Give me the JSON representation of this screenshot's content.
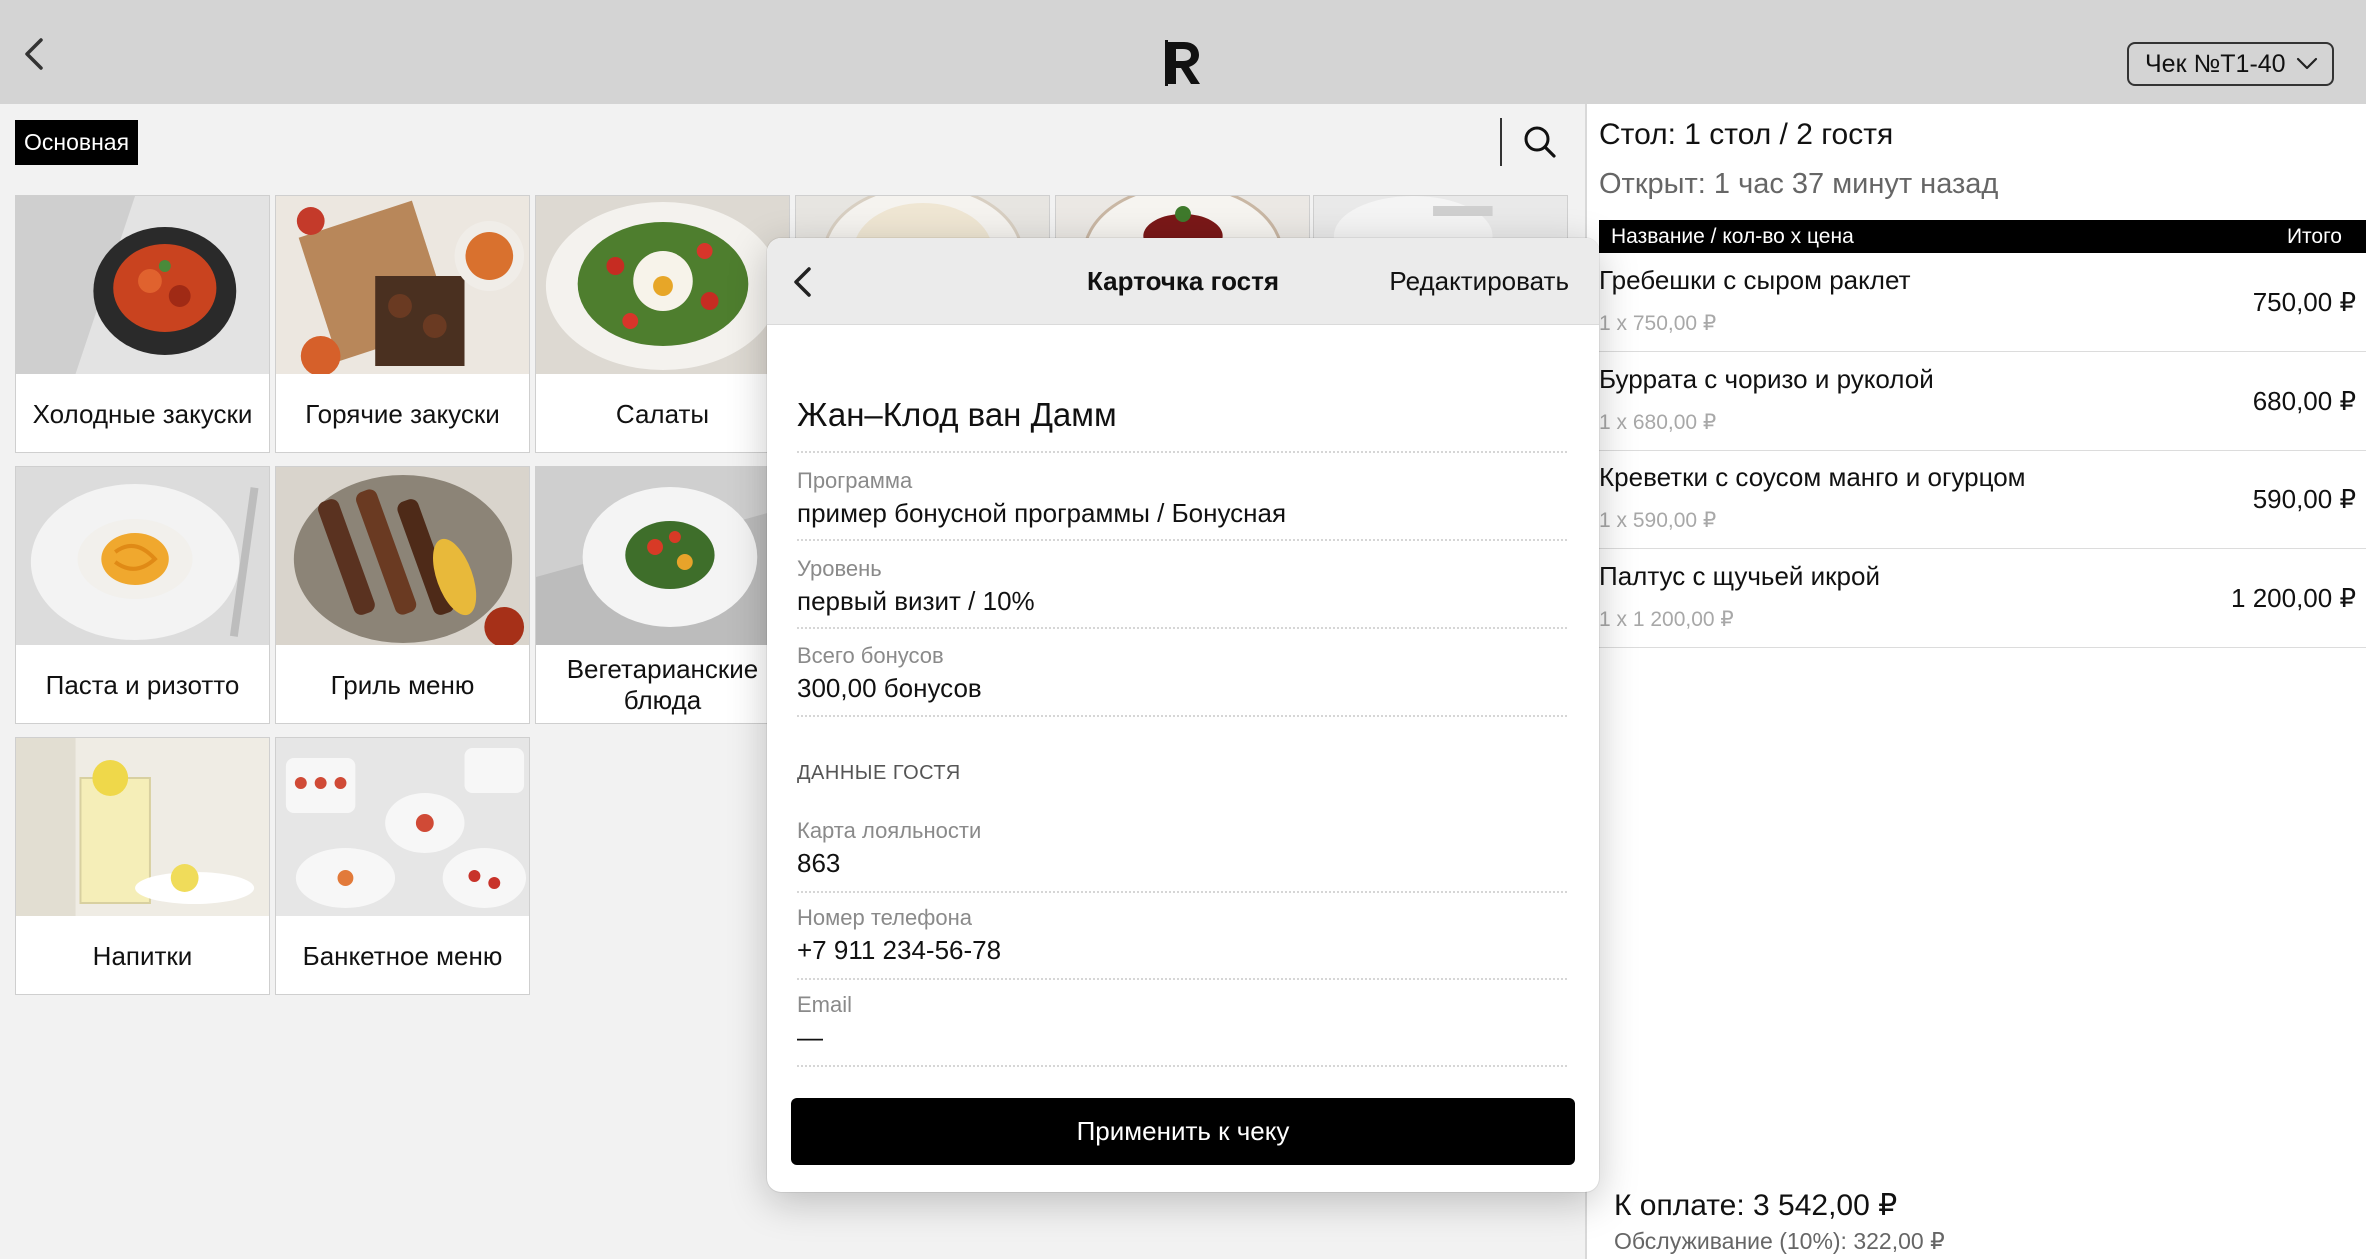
{
  "header": {
    "logo_letter": "R",
    "check_selector": "Чек №Т1-40"
  },
  "menu": {
    "active_tab": "Основная",
    "categories": [
      {
        "label": "Холодные закуски"
      },
      {
        "label": "Горячие закуски"
      },
      {
        "label": "Салаты"
      },
      {
        "label": "Паста и ризотто"
      },
      {
        "label": "Гриль меню"
      },
      {
        "label": "Вегетарианские блюда"
      },
      {
        "label": "Напитки"
      },
      {
        "label": "Банкетное меню"
      }
    ]
  },
  "guest_card": {
    "title": "Карточка гостя",
    "edit_label": "Редактировать",
    "guest_name": "Жан–Клод ван Дамм",
    "program_label": "Программа",
    "program_value": "пример бонусной программы / Бонусная",
    "level_label": "Уровень",
    "level_value": "первый визит / 10%",
    "bonuses_label": "Всего бонусов",
    "bonuses_value": "300,00 бонусов",
    "section_title": "ДАННЫЕ ГОСТЯ",
    "card_label": "Карта лояльности",
    "card_value": "863",
    "phone_label": "Номер телефона",
    "phone_value": "+7 911 234-56-78",
    "email_label": "Email",
    "email_value": "—",
    "apply_label": "Применить к чеку"
  },
  "order": {
    "table_info": "Стол: 1 стол / 2 гостя",
    "opened_info": "Открыт: 1 час 37 минут назад",
    "col_name": "Название / кол-во x цена",
    "col_total": "Итого",
    "items": [
      {
        "name": "Гребешки с сыром раклет",
        "qty": "1 x 750,00 ₽",
        "total": "750,00 ₽"
      },
      {
        "name": "Буррата с чоризо и руколой",
        "qty": "1 x 680,00 ₽",
        "total": "680,00 ₽"
      },
      {
        "name": "Креветки с соусом манго и огурцом",
        "qty": "1 x 590,00 ₽",
        "total": "590,00 ₽"
      },
      {
        "name": "Палтус с щучьей икрой",
        "qty": "1 x 1 200,00 ₽",
        "total": "1 200,00 ₽"
      }
    ],
    "to_pay": "К оплате: 3 542,00 ₽",
    "service": "Обслуживание (10%): 322,00 ₽"
  }
}
